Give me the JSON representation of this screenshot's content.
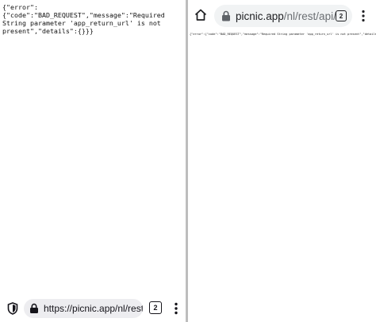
{
  "left_pane": {
    "json_body": "{\"error\":\n{\"code\":\"BAD_REQUEST\",\"message\":\"Required\nString parameter 'app_return_url' is not\npresent\",\"details\":{}}}",
    "toolbar": {
      "url": "https://picnic.app/nl/rest/api",
      "tab_count": "2"
    }
  },
  "right_pane": {
    "toolbar": {
      "url_host": "picnic.app",
      "url_path": "/nl/rest/api/",
      "tab_count": "2"
    },
    "json_body": "{\"error\":{\"code\":\"BAD_REQUEST\",\"message\":\"Required String parameter 'app_return_url' is not present\",\"details\":{}}}"
  },
  "icons": {
    "shield": "shield-icon",
    "lock": "lock-icon",
    "menu": "kebab-menu-icon",
    "home": "home-icon",
    "tabs": "tabs-icon"
  }
}
